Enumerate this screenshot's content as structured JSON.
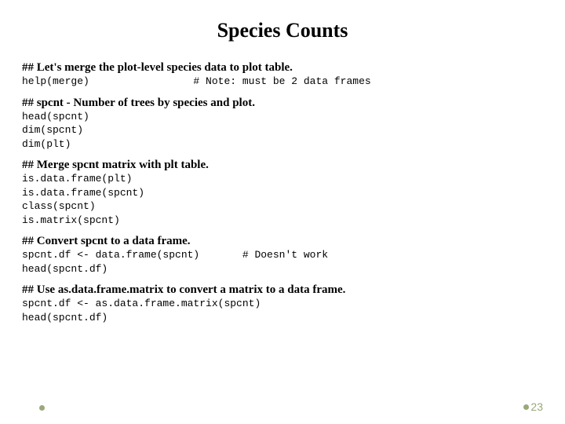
{
  "title": "Species Counts",
  "sections": [
    {
      "heading": "## Let's merge the plot-level species data to plot table.",
      "code": "help(merge)                 # Note: must be 2 data frames"
    },
    {
      "heading": "## spcnt - Number of trees by species and plot.",
      "code": "head(spcnt)\ndim(spcnt)\ndim(plt)"
    },
    {
      "heading": "## Merge spcnt matrix with plt table.",
      "code": "is.data.frame(plt)\nis.data.frame(spcnt)\nclass(spcnt)\nis.matrix(spcnt)"
    },
    {
      "heading": "## Convert spcnt to a data frame.",
      "code": "spcnt.df <- data.frame(spcnt)       # Doesn't work\nhead(spcnt.df)"
    },
    {
      "heading": "## Use as.data.frame.matrix to convert a matrix to a data frame.",
      "code": "spcnt.df <- as.data.frame.matrix(spcnt)\nhead(spcnt.df)"
    }
  ],
  "pageNumber": "23"
}
